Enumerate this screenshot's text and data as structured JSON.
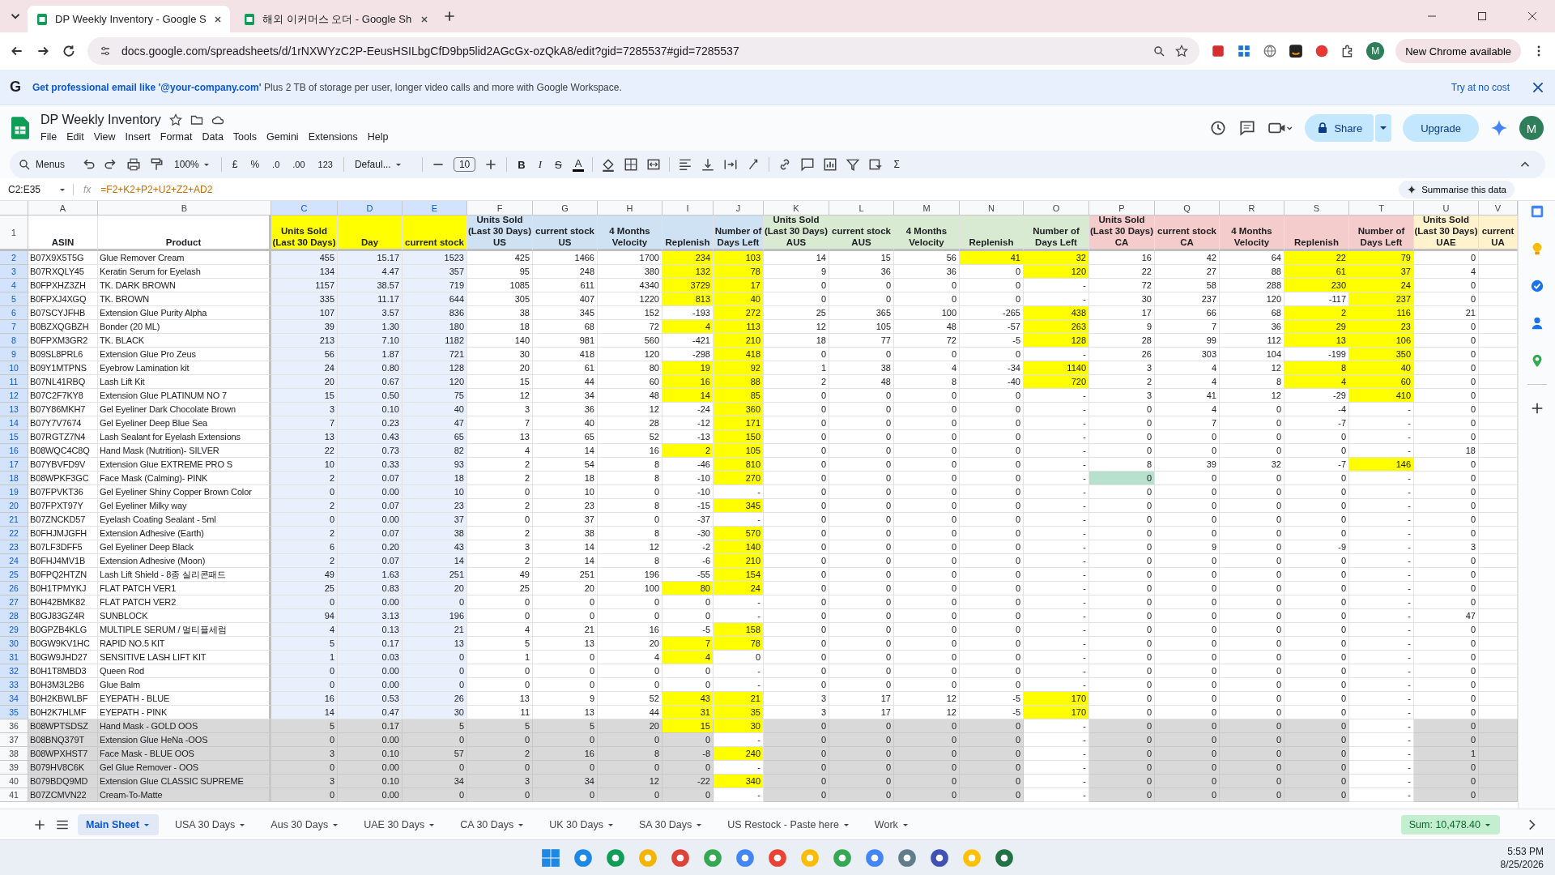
{
  "browser": {
    "tabs": [
      {
        "title": "DP Weekly Inventory - Google S",
        "selected": true
      },
      {
        "title": "해외 이커머스 오더 - Google Sh",
        "selected": false
      }
    ],
    "url": "docs.google.com/spreadsheets/d/1rNXWYzC2P-EeusHSILbgCfD9bp5lid2AGcGx-ozQkA8/edit?gid=7285537#gid=7285537",
    "profile": "M",
    "update_button": "New Chrome available"
  },
  "banner": {
    "logo": "G",
    "text": "**Get professional email like '@your-company.com'** Plus 2 TB of storage per user, longer video calls and more with Google Workspace.",
    "action": "Try at no cost"
  },
  "doc": {
    "title": "DP Weekly Inventory",
    "menus": [
      "File",
      "Edit",
      "View",
      "Insert",
      "Format",
      "Data",
      "Tools",
      "Gemini",
      "Extensions",
      "Help"
    ],
    "share": "Share",
    "upgrade": "Upgrade",
    "avatar": "M"
  },
  "toolbar": {
    "search": "Menus",
    "zoom": "100%",
    "currency": "£",
    "percent": "%",
    "decrease_decimal": ".0",
    "increase_decimal": ".00",
    "number_format": "123",
    "font": "Defaul...",
    "font_size": "10",
    "bold": "B",
    "italic": "I",
    "strikethrough": "S",
    "text_color": "A",
    "functions": "Σ"
  },
  "formula_bar": {
    "name_box": "C2:E35",
    "fx": "fx",
    "formula": "=F2+K2+P2+U2+Z2+AD2",
    "summarise": "Summarise this data"
  },
  "columns": [
    {
      "letter": "A",
      "header": "ASIN",
      "color": "#ffffff",
      "selected": false
    },
    {
      "letter": "B",
      "header": "Product",
      "color": "#ffffff",
      "selected": false
    },
    {
      "letter": "C",
      "header": "Units Sold\n(Last 30 Days)",
      "color": "#ffff00",
      "selected": true
    },
    {
      "letter": "D",
      "header": "Day",
      "color": "#ffff00",
      "selected": true
    },
    {
      "letter": "E",
      "header": "current stock",
      "color": "#ffff00",
      "selected": true
    },
    {
      "letter": "F",
      "header": "Units Sold\n(Last 30 Days)\nUS",
      "color": "#cfe2f3",
      "selected": false
    },
    {
      "letter": "G",
      "header": "current stock\nUS",
      "color": "#cfe2f3",
      "selected": false
    },
    {
      "letter": "H",
      "header": "4 Months\nVelocity",
      "color": "#cfe2f3",
      "selected": false
    },
    {
      "letter": "I",
      "header": "Replenish",
      "color": "#cfe2f3",
      "selected": false
    },
    {
      "letter": "J",
      "header": "Number of\nDays Left",
      "color": "#cfe2f3",
      "selected": false
    },
    {
      "letter": "K",
      "header": "Units Sold\n(Last 30 Days)\nAUS",
      "color": "#d9ead3",
      "selected": false
    },
    {
      "letter": "L",
      "header": "current stock\nAUS",
      "color": "#d9ead3",
      "selected": false
    },
    {
      "letter": "M",
      "header": "4 Months\nVelocity",
      "color": "#d9ead3",
      "selected": false
    },
    {
      "letter": "N",
      "header": "Replenish",
      "color": "#d9ead3",
      "selected": false
    },
    {
      "letter": "O",
      "header": "Number of\nDays Left",
      "color": "#d9ead3",
      "selected": false
    },
    {
      "letter": "P",
      "header": "Units Sold\n(Last 30 Days)\nCA",
      "color": "#f4cccc",
      "selected": false
    },
    {
      "letter": "Q",
      "header": "current stock\nCA",
      "color": "#f4cccc",
      "selected": false
    },
    {
      "letter": "R",
      "header": "4 Months\nVelocity",
      "color": "#f4cccc",
      "selected": false
    },
    {
      "letter": "S",
      "header": "Replenish",
      "color": "#f4cccc",
      "selected": false
    },
    {
      "letter": "T",
      "header": "Number of\nDays Left",
      "color": "#f4cccc",
      "selected": false
    },
    {
      "letter": "U",
      "header": "Units Sold\n(Last 30 Days)\nUAE",
      "color": "#fff2cc",
      "selected": false
    },
    {
      "letter": "V",
      "header": "current\nUA",
      "color": "#fff2cc",
      "selected": false
    }
  ],
  "header_row": "1",
  "rows": [
    {
      "number": "2",
      "selected": true,
      "shaded": false,
      "cells": [
        "B07X9X5T5G",
        "Glue Remover Cream",
        "455",
        "15.17",
        "1523",
        "425",
        "1466",
        "1700",
        {
          "text": "234",
          "color": "#ffff00"
        },
        {
          "text": "103",
          "color": "#ffff00"
        },
        "14",
        "15",
        "56",
        {
          "text": "41",
          "color": "#ffff00"
        },
        {
          "text": "32",
          "color": "#ffff00"
        },
        "16",
        "42",
        "64",
        {
          "text": "22",
          "color": "#ffff00"
        },
        {
          "text": "79",
          "color": "#ffff00"
        },
        "0"
      ]
    },
    {
      "number": "3",
      "selected": true,
      "shaded": false,
      "cells": [
        "B07RXQLY45",
        "Keratin Serum for Eyelash",
        "134",
        "4.47",
        "357",
        "95",
        "248",
        "380",
        {
          "text": "132",
          "color": "#ffff00"
        },
        {
          "text": "78",
          "color": "#ffff00"
        },
        "9",
        "36",
        "36",
        "0",
        {
          "text": "120",
          "color": "#ffff00"
        },
        "22",
        "27",
        "88",
        {
          "text": "61",
          "color": "#ffff00"
        },
        {
          "text": "37",
          "color": "#ffff00"
        },
        "4"
      ]
    },
    {
      "number": "4",
      "selected": true,
      "shaded": false,
      "cells": [
        "B0FPXHZ3ZH",
        "TK. DARK BROWN",
        "1157",
        "38.57",
        "719",
        "1085",
        "611",
        "4340",
        {
          "text": "3729",
          "color": "#ffff00"
        },
        {
          "text": "17",
          "color": "#ffff00"
        },
        "0",
        "0",
        "0",
        "0",
        "-",
        "72",
        "58",
        "288",
        {
          "text": "230",
          "color": "#ffff00"
        },
        {
          "text": "24",
          "color": "#ffff00"
        },
        "0"
      ]
    },
    {
      "number": "5",
      "selected": true,
      "shaded": false,
      "cells": [
        "B0FPXJ4XGQ",
        "TK. BROWN",
        "335",
        "11.17",
        "644",
        "305",
        "407",
        "1220",
        {
          "text": "813",
          "color": "#ffff00"
        },
        {
          "text": "40",
          "color": "#ffff00"
        },
        "0",
        "0",
        "0",
        "0",
        "-",
        "30",
        "237",
        "120",
        "-117",
        {
          "text": "237",
          "color": "#ffff00"
        },
        "0"
      ]
    },
    {
      "number": "6",
      "selected": true,
      "shaded": false,
      "cells": [
        "B07SCYJFHB",
        "Extension Glue Purity Alpha",
        "107",
        "3.57",
        "836",
        "38",
        "345",
        "152",
        "-193",
        {
          "text": "272",
          "color": "#ffff00"
        },
        "25",
        "365",
        "100",
        "-265",
        {
          "text": "438",
          "color": "#ffff00"
        },
        "17",
        "66",
        "68",
        {
          "text": "2",
          "color": "#ffff00"
        },
        {
          "text": "116",
          "color": "#ffff00"
        },
        "21"
      ]
    },
    {
      "number": "7",
      "selected": true,
      "shaded": false,
      "cells": [
        "B0BZXQGBZH",
        "Bonder (20 ML)",
        "39",
        "1.30",
        "180",
        "18",
        "68",
        "72",
        {
          "text": "4",
          "color": "#ffff00"
        },
        {
          "text": "113",
          "color": "#ffff00"
        },
        "12",
        "105",
        "48",
        "-57",
        {
          "text": "263",
          "color": "#ffff00"
        },
        "9",
        "7",
        "36",
        {
          "text": "29",
          "color": "#ffff00"
        },
        {
          "text": "23",
          "color": "#ffff00"
        },
        "0"
      ]
    },
    {
      "number": "8",
      "selected": true,
      "shaded": false,
      "cells": [
        "B0FPXM3GR2",
        "TK. BLACK",
        "213",
        "7.10",
        "1182",
        "140",
        "981",
        "560",
        "-421",
        {
          "text": "210",
          "color": "#ffff00"
        },
        "18",
        "77",
        "72",
        "-5",
        {
          "text": "128",
          "color": "#ffff00"
        },
        "28",
        "99",
        "112",
        {
          "text": "13",
          "color": "#ffff00"
        },
        {
          "text": "106",
          "color": "#ffff00"
        },
        "0"
      ]
    },
    {
      "number": "9",
      "selected": true,
      "shaded": false,
      "cells": [
        "B09SL8PRL6",
        "Extension Glue Pro Zeus",
        "56",
        "1.87",
        "721",
        "30",
        "418",
        "120",
        "-298",
        {
          "text": "418",
          "color": "#ffff00"
        },
        "0",
        "0",
        "0",
        "0",
        "-",
        "26",
        "303",
        "104",
        "-199",
        {
          "text": "350",
          "color": "#ffff00"
        },
        "0"
      ]
    },
    {
      "number": "10",
      "selected": true,
      "shaded": false,
      "cells": [
        "B09Y1MTPNS",
        "Eyebrow Lamination kit",
        "24",
        "0.80",
        "128",
        "20",
        "61",
        "80",
        {
          "text": "19",
          "color": "#ffff00"
        },
        {
          "text": "92",
          "color": "#ffff00"
        },
        "1",
        "38",
        "4",
        "-34",
        {
          "text": "1140",
          "color": "#ffff00"
        },
        "3",
        "4",
        "12",
        {
          "text": "8",
          "color": "#ffff00"
        },
        {
          "text": "40",
          "color": "#ffff00"
        },
        "0"
      ]
    },
    {
      "number": "11",
      "selected": true,
      "shaded": false,
      "cells": [
        "B07NL41RBQ",
        "Lash Lift Kit",
        "20",
        "0.67",
        "120",
        "15",
        "44",
        "60",
        {
          "text": "16",
          "color": "#ffff00"
        },
        {
          "text": "88",
          "color": "#ffff00"
        },
        "2",
        "48",
        "8",
        "-40",
        {
          "text": "720",
          "color": "#ffff00"
        },
        "2",
        "4",
        "8",
        {
          "text": "4",
          "color": "#ffff00"
        },
        {
          "text": "60",
          "color": "#ffff00"
        },
        "0"
      ]
    },
    {
      "number": "12",
      "selected": true,
      "shaded": false,
      "cells": [
        "B07C2F7KY8",
        "Extension Glue PLATINUM NO 7",
        "15",
        "0.50",
        "75",
        "12",
        "34",
        "48",
        {
          "text": "14",
          "color": "#ffff00"
        },
        {
          "text": "85",
          "color": "#ffff00"
        },
        "0",
        "0",
        "0",
        "0",
        "-",
        "3",
        "41",
        "12",
        "-29",
        {
          "text": "410",
          "color": "#ffff00"
        },
        "0"
      ]
    },
    {
      "number": "13",
      "selected": true,
      "shaded": false,
      "cells": [
        "B07Y86MKH7",
        "Gel Eyeliner Dark Chocolate Brown",
        "3",
        "0.10",
        "40",
        "3",
        "36",
        "12",
        "-24",
        {
          "text": "360",
          "color": "#ffff00"
        },
        "0",
        "0",
        "0",
        "0",
        "-",
        "0",
        "4",
        "0",
        "-4",
        "-",
        "0"
      ]
    },
    {
      "number": "14",
      "selected": true,
      "shaded": false,
      "cells": [
        "B07Y7V7674",
        "Gel Eyeliner Deep Blue Sea",
        "7",
        "0.23",
        "47",
        "7",
        "40",
        "28",
        "-12",
        {
          "text": "171",
          "color": "#ffff00"
        },
        "0",
        "0",
        "0",
        "0",
        "-",
        "0",
        "7",
        "0",
        "-7",
        "-",
        "0"
      ]
    },
    {
      "number": "15",
      "selected": true,
      "shaded": false,
      "cells": [
        "B07RGTZ7N4",
        "Lash Sealant for Eyelash Extensions",
        "13",
        "0.43",
        "65",
        "13",
        "65",
        "52",
        "-13",
        {
          "text": "150",
          "color": "#ffff00"
        },
        "0",
        "0",
        "0",
        "0",
        "-",
        "0",
        "0",
        "0",
        "0",
        "-",
        "0"
      ]
    },
    {
      "number": "16",
      "selected": true,
      "shaded": false,
      "cells": [
        "B08WQC4C8Q",
        "Hand Mask (Nutrition)- SILVER",
        "22",
        "0.73",
        "82",
        "4",
        "14",
        "16",
        {
          "text": "2",
          "color": "#ffff00"
        },
        {
          "text": "105",
          "color": "#ffff00"
        },
        "0",
        "0",
        "0",
        "0",
        "-",
        "0",
        "0",
        "0",
        "0",
        "-",
        "18"
      ]
    },
    {
      "number": "17",
      "selected": true,
      "shaded": false,
      "cells": [
        "B07YBVFD9V",
        "Extension Glue EXTREME PRO S",
        "10",
        "0.33",
        "93",
        "2",
        "54",
        "8",
        "-46",
        {
          "text": "810",
          "color": "#ffff00"
        },
        "0",
        "0",
        "0",
        "0",
        "-",
        "8",
        "39",
        "32",
        "-7",
        {
          "text": "146",
          "color": "#ffff00"
        },
        "0"
      ]
    },
    {
      "number": "18",
      "selected": true,
      "shaded": false,
      "cells": [
        "B08WPKF3GC",
        "Face Mask (Calming)- PINK",
        "2",
        "0.07",
        "18",
        "2",
        "18",
        "8",
        "-10",
        {
          "text": "270",
          "color": "#ffff00"
        },
        "0",
        "0",
        "0",
        "0",
        "-",
        {
          "text": "0",
          "color": "#b7e1cd"
        },
        "0",
        "0",
        "0",
        "-",
        "0"
      ]
    },
    {
      "number": "19",
      "selected": true,
      "shaded": false,
      "cells": [
        "B07FPVKT36",
        "Gel Eyeliner Shiny Copper Brown Color",
        "0",
        "0.00",
        "10",
        "0",
        "10",
        "0",
        "-10",
        "-",
        "0",
        "0",
        "0",
        "0",
        "-",
        "0",
        "0",
        "0",
        "0",
        "-",
        "0"
      ]
    },
    {
      "number": "20",
      "selected": true,
      "shaded": false,
      "cells": [
        "B07FPXT97Y",
        "Gel Eyeliner Milky way",
        "2",
        "0.07",
        "23",
        "2",
        "23",
        "8",
        "-15",
        {
          "text": "345",
          "color": "#ffff00"
        },
        "0",
        "0",
        "0",
        "0",
        "-",
        "0",
        "0",
        "0",
        "0",
        "-",
        "0"
      ]
    },
    {
      "number": "21",
      "selected": true,
      "shaded": false,
      "cells": [
        "B07ZNCKD57",
        "Eyelash Coating Sealant - 5ml",
        "0",
        "0.00",
        "37",
        "0",
        "37",
        "0",
        "-37",
        "-",
        "0",
        "0",
        "0",
        "0",
        "-",
        "0",
        "0",
        "0",
        "0",
        "-",
        "0"
      ]
    },
    {
      "number": "22",
      "selected": true,
      "shaded": false,
      "cells": [
        "B0FHJMJGFH",
        "Extension Adhesive (Earth)",
        "2",
        "0.07",
        "38",
        "2",
        "38",
        "8",
        "-30",
        {
          "text": "570",
          "color": "#ffff00"
        },
        "0",
        "0",
        "0",
        "0",
        "-",
        "0",
        "0",
        "0",
        "0",
        "-",
        "0"
      ]
    },
    {
      "number": "23",
      "selected": true,
      "shaded": false,
      "cells": [
        "B07LF3DFF5",
        "Gel Eyeliner Deep Black",
        "6",
        "0.20",
        "43",
        "3",
        "14",
        "12",
        "-2",
        {
          "text": "140",
          "color": "#ffff00"
        },
        "0",
        "0",
        "0",
        "0",
        "-",
        "0",
        "9",
        "0",
        "-9",
        "-",
        "3"
      ]
    },
    {
      "number": "24",
      "selected": true,
      "shaded": false,
      "cells": [
        "B0FHJ4MV1B",
        "Extension Adhesive (Moon)",
        "2",
        "0.07",
        "14",
        "2",
        "14",
        "8",
        "-6",
        {
          "text": "210",
          "color": "#ffff00"
        },
        "0",
        "0",
        "0",
        "0",
        "-",
        "0",
        "0",
        "0",
        "0",
        "-",
        "0"
      ]
    },
    {
      "number": "25",
      "selected": true,
      "shaded": false,
      "cells": [
        "B0FPQ2HTZN",
        "Lash Lift Shield - 8종 실리콘패드",
        "49",
        "1.63",
        "251",
        "49",
        "251",
        "196",
        "-55",
        {
          "text": "154",
          "color": "#ffff00"
        },
        "0",
        "0",
        "0",
        "0",
        "-",
        "0",
        "0",
        "0",
        "0",
        "-",
        "0"
      ]
    },
    {
      "number": "26",
      "selected": true,
      "shaded": false,
      "cells": [
        "B0H1TPMYKJ",
        "FLAT PATCH VER1",
        "25",
        "0.83",
        "20",
        "25",
        "20",
        "100",
        {
          "text": "80",
          "color": "#ffff00"
        },
        {
          "text": "24",
          "color": "#ffff00"
        },
        "0",
        "0",
        "0",
        "0",
        "-",
        "0",
        "0",
        "0",
        "0",
        "-",
        "0"
      ]
    },
    {
      "number": "27",
      "selected": true,
      "shaded": false,
      "cells": [
        "B0H42BMK82",
        "FLAT PATCH VER2",
        "0",
        "0.00",
        "0",
        "0",
        "0",
        "0",
        "0",
        "-",
        "0",
        "0",
        "0",
        "0",
        "-",
        "0",
        "0",
        "0",
        "0",
        "-",
        "0"
      ]
    },
    {
      "number": "28",
      "selected": true,
      "shaded": false,
      "cells": [
        "B0GJ83GZ4R",
        "SUNBLOCK",
        "94",
        "3.13",
        "196",
        "0",
        "0",
        "0",
        "0",
        "-",
        "0",
        "0",
        "0",
        "0",
        "-",
        "0",
        "0",
        "0",
        "0",
        "-",
        "47"
      ]
    },
    {
      "number": "29",
      "selected": true,
      "shaded": false,
      "cells": [
        "B0GPZB4KLG",
        "MULTIPLE SERUM / 멀티플세럼",
        "4",
        "0.13",
        "21",
        "4",
        "21",
        "16",
        "-5",
        {
          "text": "158",
          "color": "#ffff00"
        },
        "0",
        "0",
        "0",
        "0",
        "-",
        "0",
        "0",
        "0",
        "0",
        "-",
        "0"
      ]
    },
    {
      "number": "30",
      "selected": true,
      "shaded": false,
      "cells": [
        "B0GW9KV1HC",
        "RAPID NO.5 KIT",
        "5",
        "0.17",
        "13",
        "5",
        "13",
        "20",
        {
          "text": "7",
          "color": "#ffff00"
        },
        {
          "text": "78",
          "color": "#ffff00"
        },
        "0",
        "0",
        "0",
        "0",
        "-",
        "0",
        "0",
        "0",
        "0",
        "-",
        "0"
      ]
    },
    {
      "number": "31",
      "selected": true,
      "shaded": false,
      "cells": [
        "B0GW9JHD27",
        "SENSITIVE LASH LIFT KIT",
        "1",
        "0.03",
        "0",
        "1",
        "0",
        "4",
        {
          "text": "4",
          "color": "#ffff00"
        },
        "0",
        "0",
        "0",
        "0",
        "0",
        "-",
        "0",
        "0",
        "0",
        "0",
        "-",
        "0"
      ]
    },
    {
      "number": "32",
      "selected": true,
      "shaded": false,
      "cells": [
        "B0H1T8MBD3",
        "Queen Rod",
        "0",
        "0.00",
        "0",
        "0",
        "0",
        "0",
        "0",
        "-",
        "0",
        "0",
        "0",
        "0",
        "-",
        "0",
        "0",
        "0",
        "0",
        "-",
        "0"
      ]
    },
    {
      "number": "33",
      "selected": true,
      "shaded": false,
      "cells": [
        "B0H3M3L2B6",
        "Glue Balm",
        "0",
        "0.00",
        "0",
        "0",
        "0",
        "0",
        "0",
        "-",
        "0",
        "0",
        "0",
        "0",
        "-",
        "0",
        "0",
        "0",
        "0",
        "-",
        "0"
      ]
    },
    {
      "number": "34",
      "selected": true,
      "shaded": false,
      "cells": [
        "B0H2KBWLBF",
        "EYEPATH - BLUE",
        "16",
        "0.53",
        "26",
        "13",
        "9",
        "52",
        {
          "text": "43",
          "color": "#ffff00"
        },
        {
          "text": "21",
          "color": "#ffff00"
        },
        "3",
        "17",
        "12",
        "-5",
        {
          "text": "170",
          "color": "#ffff00"
        },
        "0",
        "0",
        "0",
        "0",
        "-",
        "0"
      ]
    },
    {
      "number": "35",
      "selected": true,
      "shaded": false,
      "cells": [
        "B0H2K7HLMF",
        "EYEPATH - PINK",
        "14",
        "0.47",
        "30",
        "11",
        "13",
        "44",
        {
          "text": "31",
          "color": "#ffff00"
        },
        {
          "text": "35",
          "color": "#ffff00"
        },
        "3",
        "17",
        "12",
        "-5",
        {
          "text": "170",
          "color": "#ffff00"
        },
        "0",
        "0",
        "0",
        "0",
        "-",
        "0"
      ]
    },
    {
      "number": "36",
      "selected": false,
      "shaded": true,
      "cells": [
        "B08WPTSDSZ",
        "Hand Mask - GOLD OOS",
        "5",
        "0.17",
        "5",
        "5",
        "5",
        "20",
        {
          "text": "15",
          "color": "#ffff00"
        },
        {
          "text": "30",
          "color": "#ffff00"
        },
        "0",
        "0",
        "0",
        "0",
        "-",
        "0",
        "0",
        "0",
        "0",
        "-",
        "0"
      ]
    },
    {
      "number": "37",
      "selected": false,
      "shaded": true,
      "cells": [
        "B08BNQ379T",
        "Extension Glue HeNa -OOS",
        "0",
        "0.00",
        "0",
        "0",
        "0",
        "0",
        "0",
        "-",
        "0",
        "0",
        "0",
        "0",
        "-",
        "0",
        "0",
        "0",
        "0",
        "-",
        "0"
      ]
    },
    {
      "number": "38",
      "selected": false,
      "shaded": true,
      "cells": [
        "B08WPXHST7",
        "Face Mask - BLUE OOS",
        "3",
        "0.10",
        "57",
        "2",
        "16",
        "8",
        "-8",
        {
          "text": "240",
          "color": "#ffff00"
        },
        "0",
        "0",
        "0",
        "0",
        "-",
        "0",
        "0",
        "0",
        "0",
        "-",
        "1"
      ]
    },
    {
      "number": "39",
      "selected": false,
      "shaded": true,
      "cells": [
        "B079HV8C6K",
        "Gel Glue Remover - OOS",
        "0",
        "0.00",
        "0",
        "0",
        "0",
        "0",
        "0",
        "-",
        "0",
        "0",
        "0",
        "0",
        "-",
        "0",
        "0",
        "0",
        "0",
        "-",
        "0"
      ]
    },
    {
      "number": "40",
      "selected": false,
      "shaded": true,
      "cells": [
        "B079BDQ9MD",
        "Extension Glue  CLASSIC SUPREME",
        "3",
        "0.10",
        "34",
        "3",
        "34",
        "12",
        "-22",
        {
          "text": "340",
          "color": "#ffff00"
        },
        "0",
        "0",
        "0",
        "0",
        "-",
        "0",
        "0",
        "0",
        "0",
        "-",
        "0"
      ]
    },
    {
      "number": "41",
      "selected": false,
      "shaded": true,
      "cells": [
        "B07ZCMVN22",
        "Cream-To-Matte",
        "0",
        "0.00",
        "0",
        "0",
        "0",
        "0",
        "0",
        "-",
        "0",
        "0",
        "0",
        "0",
        "-",
        "0",
        "0",
        "0",
        "0",
        "-",
        "0"
      ]
    }
  ],
  "sheet_tabs": [
    {
      "label": "Main Sheet",
      "selected": true
    },
    {
      "label": "USA 30 Days",
      "selected": false
    },
    {
      "label": "Aus 30 Days",
      "selected": false
    },
    {
      "label": "UAE 30 Days",
      "selected": false
    },
    {
      "label": "CA 30 Days",
      "selected": false
    },
    {
      "label": "UK 30 Days",
      "selected": false
    },
    {
      "label": "SA 30 Days",
      "selected": false
    },
    {
      "label": "US Restock - Paste here",
      "selected": false
    },
    {
      "label": "Work",
      "selected": false
    }
  ],
  "sum": "Sum: 10,478.40",
  "taskbar": {
    "time": "5:53 PM",
    "date": "8/25/2026"
  }
}
